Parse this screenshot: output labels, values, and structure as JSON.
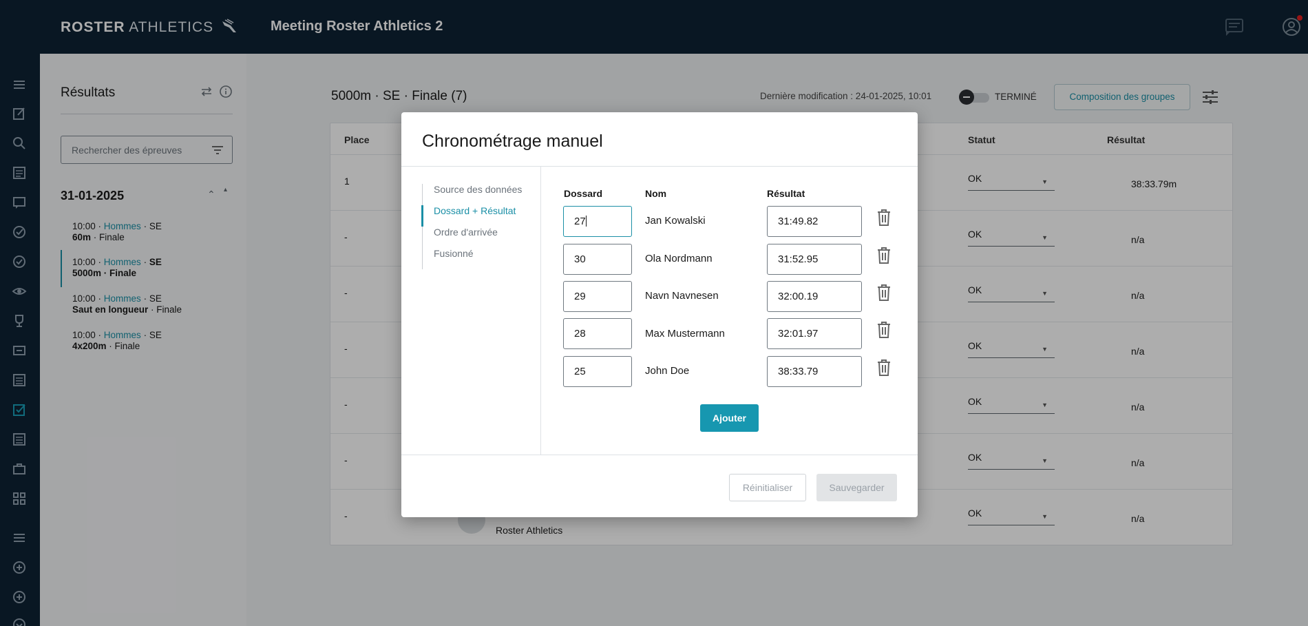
{
  "app": {
    "logo_bold": "ROSTER",
    "logo_light": "ATHLETICS",
    "meeting_title": "Meeting Roster Athletics 2"
  },
  "side": {
    "title": "Résultats",
    "search_placeholder": "Rechercher des épreuves",
    "date": "31-01-2025",
    "events": [
      {
        "time": "10:00",
        "team": "Hommes",
        "cat": "SE",
        "event": "60m",
        "round": "Finale"
      },
      {
        "time": "10:00",
        "team": "Hommes",
        "cat": "SE",
        "event": "5000m",
        "round": "Finale"
      },
      {
        "time": "10:00",
        "team": "Hommes",
        "cat": "SE",
        "event": "Saut en longueur",
        "round": "Finale"
      },
      {
        "time": "10:00",
        "team": "Hommes",
        "cat": "SE",
        "event": "4x200m",
        "round": "Finale"
      }
    ]
  },
  "main": {
    "title": "5000m · SE · Finale (7)",
    "last_modified": "Dernière modification : 24-01-2025, 10:01",
    "status_toggle": "TERMINÉ",
    "compo_button": "Composition des groupes",
    "headers": {
      "place": "Place",
      "statut": "Statut",
      "resultat": "Résultat"
    },
    "rows": [
      {
        "place": "1",
        "statut": "OK",
        "resultat": "38:33.79m"
      },
      {
        "place": "-",
        "statut": "OK",
        "resultat": "n/a"
      },
      {
        "place": "-",
        "statut": "OK",
        "resultat": "n/a"
      },
      {
        "place": "-",
        "statut": "OK",
        "resultat": "n/a"
      },
      {
        "place": "-",
        "statut": "OK",
        "resultat": "n/a"
      },
      {
        "place": "-",
        "statut": "OK",
        "resultat": "n/a"
      },
      {
        "place": "-",
        "statut": "OK",
        "resultat": "n/a"
      }
    ],
    "peek_club": "Roster Athletics"
  },
  "dialog": {
    "title": "Chronométrage manuel",
    "steps": [
      "Source des données",
      "Dossard + Résultat",
      "Ordre d'arrivée",
      "Fusionné"
    ],
    "active_step": 1,
    "col_bib": "Dossard",
    "col_name": "Nom",
    "col_result": "Résultat",
    "entries": [
      {
        "bib": "27",
        "name": "Jan Kowalski",
        "result": "31:49.82"
      },
      {
        "bib": "30",
        "name": "Ola Nordmann",
        "result": "31:52.95"
      },
      {
        "bib": "29",
        "name": "Navn Navnesen",
        "result": "32:00.19"
      },
      {
        "bib": "28",
        "name": "Max Mustermann",
        "result": "32:01.97"
      },
      {
        "bib": "25",
        "name": "John Doe",
        "result": "38:33.79"
      }
    ],
    "add_button": "Ajouter",
    "reset_button": "Réinitialiser",
    "save_button": "Sauvegarder"
  },
  "colors": {
    "navy": "#0e2234",
    "accent": "#1797b0"
  }
}
